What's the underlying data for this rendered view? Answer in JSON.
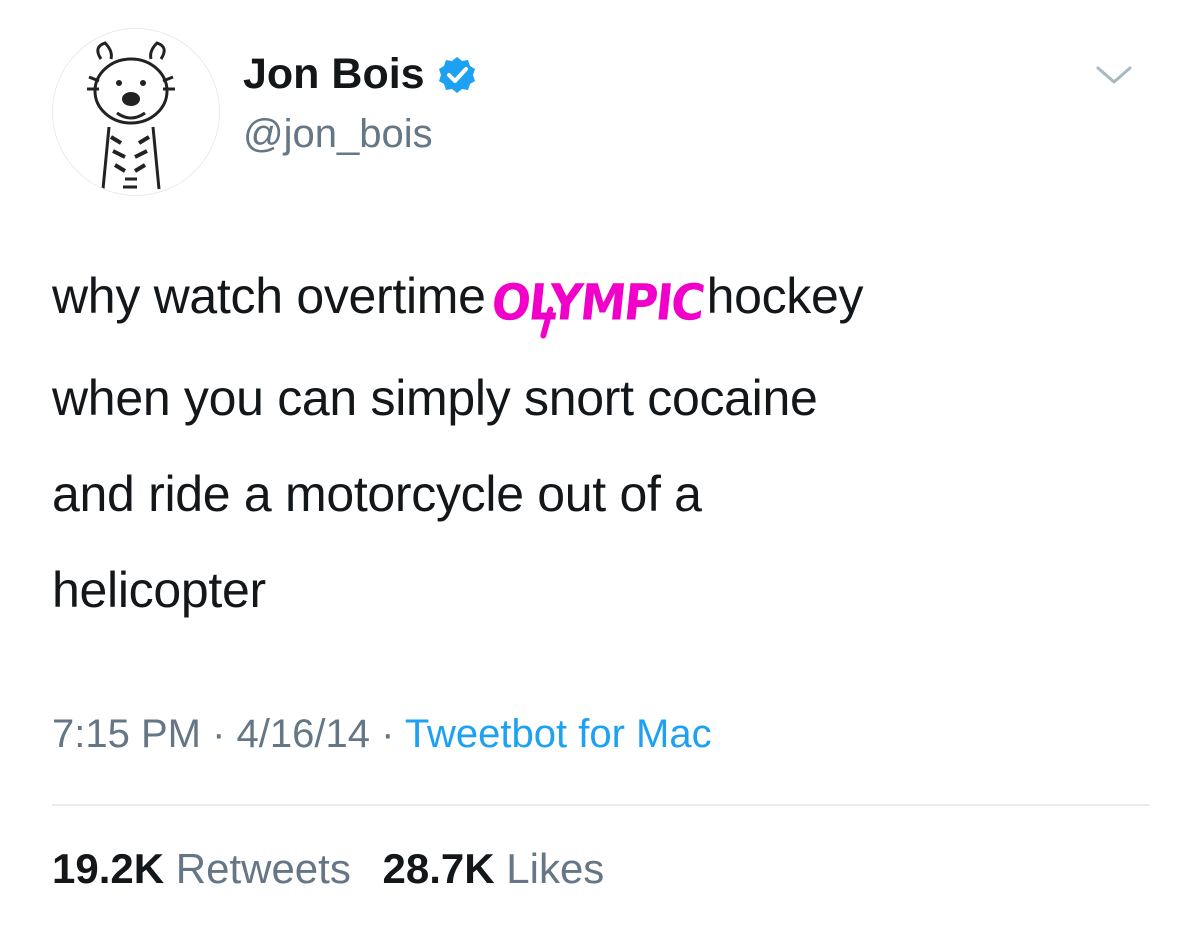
{
  "author": {
    "display_name": "Jon Bois",
    "handle": "@jon_bois",
    "verified": true,
    "avatar_icon": "cartoon-tiger-avatar"
  },
  "tweet": {
    "line1_before": "why watch overtime",
    "scrawl": "OLYMPIC",
    "line1_after": "hockey",
    "line2": "when you can simply snort cocaine",
    "line3": "and ride a motorcycle out of a",
    "line4": "helicopter"
  },
  "meta": {
    "time": "7:15 PM",
    "sep1": " · ",
    "date": "4/16/14",
    "sep2": " · ",
    "source": "Tweetbot for Mac"
  },
  "stats": {
    "retweets_count": "19.2K",
    "retweets_label": "Retweets",
    "likes_count": "28.7K",
    "likes_label": "Likes"
  },
  "colors": {
    "text": "#14171a",
    "secondary": "#657786",
    "link": "#1da1f2",
    "scrawl": "#f000c8"
  }
}
